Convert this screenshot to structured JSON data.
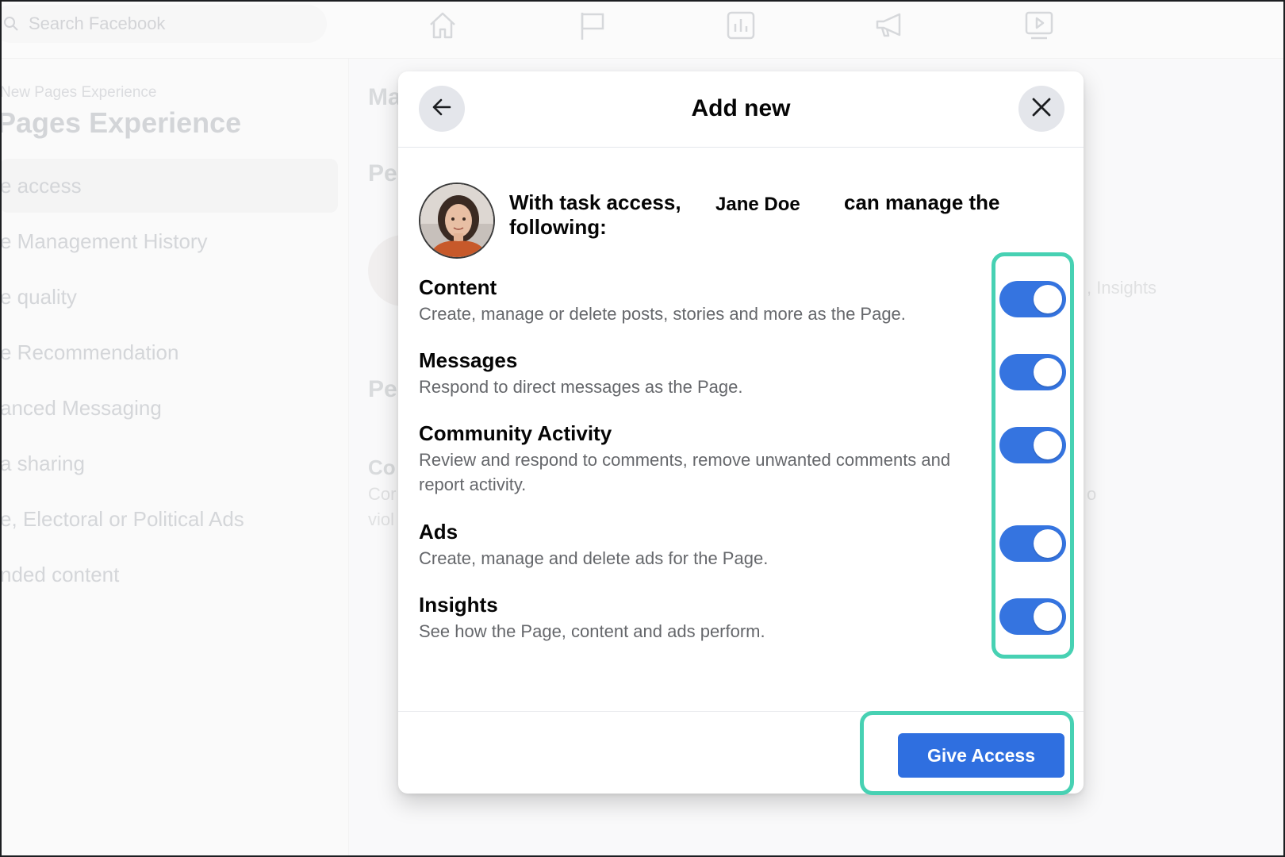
{
  "topbar": {
    "search_placeholder": "Search Facebook",
    "nav_icons": [
      "home-icon",
      "flag-icon",
      "chart-icon",
      "megaphone-icon",
      "video-icon"
    ]
  },
  "sidebar": {
    "subtitle": "New Pages Experience",
    "title": "Pages Experience",
    "items": [
      {
        "label": "e access",
        "active": true
      },
      {
        "label": "e Management History"
      },
      {
        "label": "e quality"
      },
      {
        "label": "e Recommendation"
      },
      {
        "label": "anced Messaging"
      },
      {
        "label": "a sharing"
      },
      {
        "label": "e, Electoral or Political Ads"
      },
      {
        "label": "nded content"
      }
    ]
  },
  "background_main": {
    "heading_1": "Ma",
    "heading_2": "Pe",
    "heading_3": "Pe",
    "heading_4": "Co",
    "line_1": "Cor",
    "line_2": "viol",
    "right_insights": ", Insights",
    "right_o": "o"
  },
  "modal": {
    "title": "Add new",
    "back_icon": "arrow-left-icon",
    "close_icon": "close-icon",
    "intro": {
      "prefix": "With task access,",
      "name": "Jane Doe",
      "suffix": "can manage the",
      "line2": "following:"
    },
    "permissions": [
      {
        "title": "Content",
        "desc": "Create, manage or delete posts, stories and more as the Page.",
        "enabled": true
      },
      {
        "title": "Messages",
        "desc": "Respond to direct messages as the Page.",
        "enabled": true
      },
      {
        "title": "Community Activity",
        "desc": "Review and respond to comments, remove unwanted comments and report activity.",
        "enabled": true
      },
      {
        "title": "Ads",
        "desc": "Create, manage and delete ads for the Page.",
        "enabled": true
      },
      {
        "title": "Insights",
        "desc": "See how the Page, content and ads perform.",
        "enabled": true
      }
    ],
    "primary_button": "Give Access"
  },
  "colors": {
    "accent": "#2f6fe0",
    "toggle_on": "#3574e0",
    "highlight": "#47d1b3"
  }
}
